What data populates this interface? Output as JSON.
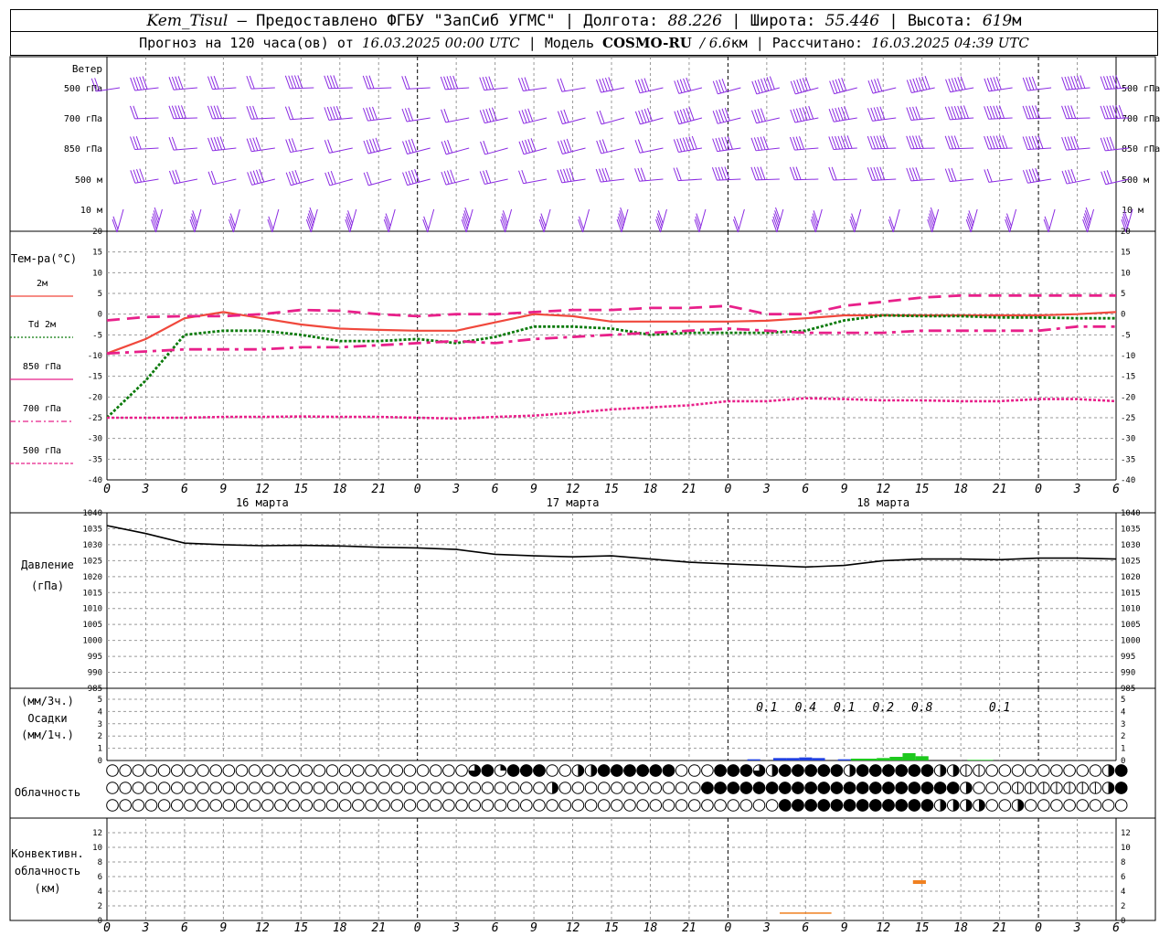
{
  "header": {
    "station": "Kem_Tisul",
    "provider": "— Предоставлено ФГБУ \"ЗапСиб УГМС\"",
    "lon_label": "Долгота:",
    "lon": "88.226",
    "lat_label": "Широта:",
    "lat": "55.446",
    "alt_label": "Высота:",
    "alt": "619",
    "alt_unit": "м",
    "forecast_label": "Прогноз на 120 часа(ов) от",
    "forecast_start": "16.03.2025 00:00 UTC",
    "model_label": "Модель",
    "model": "COSMO-RU",
    "model_res": "/ 6.6",
    "model_res_unit": "км",
    "calc_label": "Рассчитано:",
    "calc_time": "16.03.2025 04:39 UTC"
  },
  "colors": {
    "wind": "#8b2be2",
    "t2m": "#f0483c",
    "td2m": "#0a7a0a",
    "t850": "#e8208a",
    "t700": "#e8208a",
    "t500": "#e8208a",
    "pressure": "#000000",
    "precip_blue": "#2040e0",
    "precip_green": "#1ec81e",
    "conv": "#f08020"
  },
  "chart_data": [
    {
      "id": "wind",
      "type": "table",
      "title": "Ветер",
      "levels": [
        "500 гПа",
        "700 гПа",
        "850 гПа",
        "500 м",
        "10 м"
      ],
      "note": "wind barbs, every 3 hours"
    },
    {
      "id": "temperature",
      "type": "line",
      "ylabel": "Тем-ра(°C)",
      "ylim": [
        -40,
        20
      ],
      "yticks": [
        20,
        15,
        10,
        5,
        0,
        -5,
        -10,
        -15,
        -20,
        -25,
        -30,
        -35,
        -40
      ],
      "x_hours": [
        0,
        3,
        6,
        9,
        12,
        15,
        18,
        21,
        24,
        27,
        30,
        33,
        36,
        39,
        42,
        45,
        48,
        51,
        54,
        57,
        60,
        63,
        66,
        69,
        72,
        75,
        78
      ],
      "series": [
        {
          "name": "2м",
          "style": "solid",
          "values": [
            -9.5,
            -6,
            -1,
            0.5,
            -1,
            -2.5,
            -3.5,
            -3.8,
            -4,
            -4,
            -2,
            0,
            -0.5,
            -1.8,
            -1.8,
            -1.8,
            -1.8,
            -1.6,
            -1,
            -0.3,
            -0.3,
            -0.3,
            -0.3,
            -0.3,
            -0.3,
            0,
            0.5
          ]
        },
        {
          "name": "Td 2м",
          "style": "dotted",
          "values": [
            -25,
            -16,
            -5,
            -4,
            -4,
            -5,
            -6.5,
            -6.5,
            -6,
            -7,
            -5.5,
            -3,
            -3,
            -3.5,
            -5,
            -4.5,
            -4.5,
            -4.5,
            -4,
            -1.5,
            -0.3,
            -0.5,
            -0.5,
            -0.8,
            -0.8,
            -1,
            -1
          ]
        },
        {
          "name": "850 гПа",
          "style": "dashed",
          "values": [
            -1.5,
            -0.7,
            -0.5,
            -0.5,
            0,
            1,
            0.8,
            0,
            -0.5,
            0,
            0,
            0.5,
            1,
            1,
            1.5,
            1.5,
            2,
            0,
            0,
            2,
            3,
            4,
            4.5,
            4.5,
            4.5,
            4.5,
            4.5
          ]
        },
        {
          "name": "700 гПа",
          "style": "dashdot",
          "values": [
            -9.5,
            -9,
            -8.5,
            -8.5,
            -8.5,
            -8,
            -8,
            -7.5,
            -7,
            -6.5,
            -7,
            -6,
            -5.5,
            -5,
            -4.5,
            -4,
            -3.5,
            -4,
            -4.5,
            -4.5,
            -4.5,
            -4,
            -4,
            -4,
            -4,
            -3,
            -3
          ]
        },
        {
          "name": "500 гПа",
          "style": "fine",
          "values": [
            -25,
            -25,
            -25,
            -24.8,
            -24.8,
            -24.7,
            -24.8,
            -24.8,
            -25,
            -25.2,
            -24.8,
            -24.5,
            -23.8,
            -23,
            -22.5,
            -22,
            -21,
            -21,
            -20.3,
            -20.5,
            -20.8,
            -20.8,
            -21,
            -21,
            -20.5,
            -20.5,
            -21
          ]
        }
      ]
    },
    {
      "id": "pressure",
      "type": "line",
      "ylabel": "Давление",
      "ylabel2": "(гПа)",
      "ylim": [
        985,
        1040
      ],
      "yticks": [
        1040,
        1035,
        1030,
        1025,
        1020,
        1015,
        1010,
        1005,
        1000,
        995,
        990,
        985
      ],
      "x_hours": [
        0,
        3,
        6,
        9,
        12,
        15,
        18,
        21,
        24,
        27,
        30,
        33,
        36,
        39,
        42,
        45,
        48,
        51,
        54,
        57,
        60,
        63,
        66,
        69,
        72,
        75,
        78
      ],
      "series": [
        {
          "name": "",
          "values": [
            1036,
            1033.5,
            1030.5,
            1030,
            1029.7,
            1029.8,
            1029.6,
            1029.2,
            1029,
            1028.5,
            1027,
            1026.5,
            1026.2,
            1026.5,
            1025.5,
            1024.5,
            1024,
            1023.5,
            1023,
            1023.5,
            1025,
            1025.5,
            1025.5,
            1025.3,
            1025.8,
            1025.8,
            1025.5
          ]
        }
      ]
    },
    {
      "id": "precip",
      "type": "bar",
      "ylabel_top": "(мм/3ч.)",
      "ylabel_mid": "Осадки",
      "ylabel_bot": "(мм/1ч.)",
      "ylim": [
        0,
        5
      ],
      "yticks": [
        5,
        4,
        3,
        2,
        1,
        0
      ],
      "annotations": [
        {
          "hour": 51,
          "text": "0.1"
        },
        {
          "hour": 54,
          "text": "0.4"
        },
        {
          "hour": 57,
          "text": "0.1"
        },
        {
          "hour": 60,
          "text": "0.2"
        },
        {
          "hour": 63,
          "text": "0.8"
        },
        {
          "hour": 69,
          "text": "0.1"
        }
      ],
      "bars": [
        {
          "hour": 50,
          "value": 0.1,
          "color": "blue"
        },
        {
          "hour": 52,
          "value": 0.2,
          "color": "blue"
        },
        {
          "hour": 53,
          "value": 0.2,
          "color": "blue"
        },
        {
          "hour": 54,
          "value": 0.25,
          "color": "blue"
        },
        {
          "hour": 55,
          "value": 0.2,
          "color": "blue"
        },
        {
          "hour": 57,
          "value": 0.1,
          "color": "blue"
        },
        {
          "hour": 58,
          "value": 0.15,
          "color": "green"
        },
        {
          "hour": 59,
          "value": 0.15,
          "color": "green"
        },
        {
          "hour": 60,
          "value": 0.2,
          "color": "green"
        },
        {
          "hour": 61,
          "value": 0.3,
          "color": "green"
        },
        {
          "hour": 62,
          "value": 0.6,
          "color": "green"
        },
        {
          "hour": 63,
          "value": 0.35,
          "color": "green"
        },
        {
          "hour": 67,
          "value": 0.05,
          "color": "green"
        },
        {
          "hour": 68,
          "value": 0.05,
          "color": "green"
        }
      ]
    },
    {
      "id": "cloud",
      "type": "table",
      "ylabel": "Облачность",
      "rows": [
        "0000000000000000000000000000345444002244444400044432444442444444221100000000024",
        "0000000000000000000000000000000000200000000000444444444444444444442000111111124",
        "0000000000000000000000000000000000000000000000000000444444444444222200200000000"
      ]
    },
    {
      "id": "convective",
      "type": "bar",
      "ylabel1": "Конвективн.",
      "ylabel2": "облачность",
      "ylabel3": "(км)",
      "ylim": [
        0,
        14
      ],
      "yticks": [
        12,
        10,
        8,
        6,
        4,
        2,
        0
      ],
      "segments": [
        {
          "start": 52,
          "end": 56,
          "bottom": 1,
          "top": 1.1
        },
        {
          "start": 62.3,
          "end": 63.3,
          "bottom": 5,
          "top": 5.5
        }
      ]
    }
  ],
  "x_axis": {
    "hour_labels": [
      "0",
      "3",
      "6",
      "9",
      "12",
      "15",
      "18",
      "21"
    ],
    "days": [
      "16 марта",
      "17 марта",
      "18 марта"
    ]
  }
}
